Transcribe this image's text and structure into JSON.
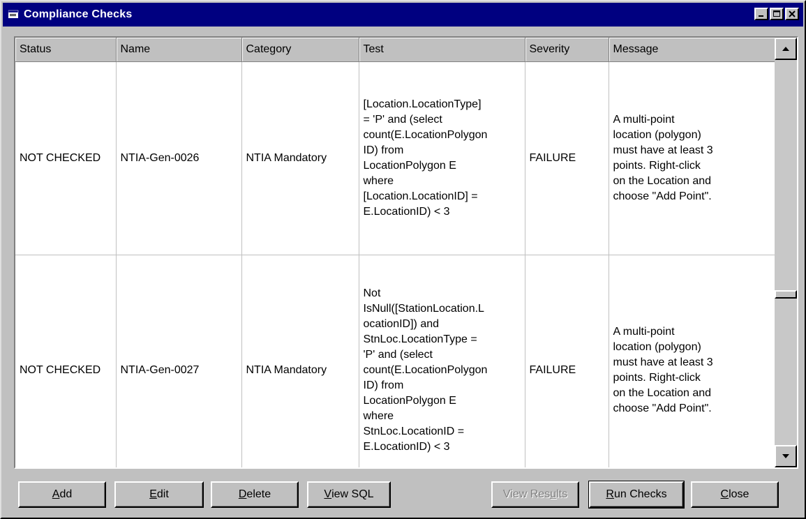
{
  "window": {
    "title": "Compliance Checks"
  },
  "grid": {
    "columns": [
      "Status",
      "Name",
      "Category",
      "Test",
      "Severity",
      "Message"
    ],
    "rows": [
      {
        "status": "NOT CHECKED",
        "name": "NTIA-Gen-0026",
        "category": "NTIA Mandatory",
        "test_lines": [
          "[Location.LocationType]",
          "=  'P' and (select",
          "count(E.LocationPolygon",
          "ID) from",
          "LocationPolygon E",
          "where",
          "[Location.LocationID] =",
          "E.LocationID) < 3"
        ],
        "severity": "FAILURE",
        "message_lines": [
          "A multi-point",
          "location (polygon)",
          "must have at least 3",
          "points.  Right-click",
          "on the Location and",
          "choose \"Add Point\"."
        ]
      },
      {
        "status": "NOT CHECKED",
        "name": "NTIA-Gen-0027",
        "category": "NTIA Mandatory",
        "test_lines": [
          "Not",
          "IsNull([StationLocation.L",
          "ocationID]) and",
          "StnLoc.LocationType  =",
          "'P' and (select",
          "count(E.LocationPolygon",
          "ID) from",
          "LocationPolygon E",
          "where",
          "StnLoc.LocationID =",
          "E.LocationID) < 3"
        ],
        "severity": "FAILURE",
        "message_lines": [
          "A multi-point",
          "location (polygon)",
          "must have at least 3",
          "points.  Right-click",
          "on the Location and",
          "choose \"Add Point\"."
        ]
      }
    ]
  },
  "buttons": {
    "add": {
      "accel": "A",
      "rest": "dd"
    },
    "edit": {
      "accel": "E",
      "rest": "dit"
    },
    "delete": {
      "accel": "D",
      "rest": "elete"
    },
    "view_sql": {
      "accel": "V",
      "rest": "iew SQL"
    },
    "view_results": {
      "pre": "View Res",
      "accel": "u",
      "rest": "lts"
    },
    "run_checks": {
      "accel": "R",
      "rest": "un Checks"
    },
    "close": {
      "accel": "C",
      "rest": "lose"
    }
  }
}
